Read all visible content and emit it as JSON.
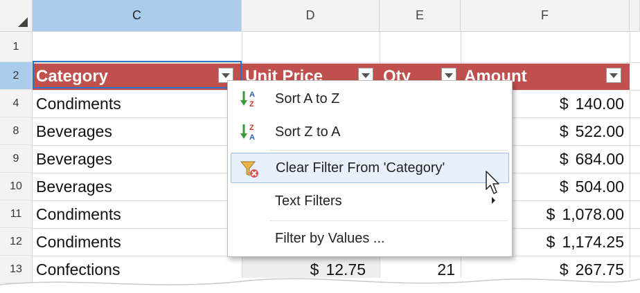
{
  "columns": [
    "C",
    "D",
    "E",
    "F"
  ],
  "rows": [
    {
      "num": "1",
      "category": "",
      "price": "",
      "qty": "",
      "amount": ""
    },
    {
      "num": "4",
      "category": "Condiments",
      "price": "",
      "qty": "",
      "amount": "140.00"
    },
    {
      "num": "8",
      "category": "Beverages",
      "price": "",
      "qty": "",
      "amount": "522.00"
    },
    {
      "num": "9",
      "category": "Beverages",
      "price": "",
      "qty": "",
      "amount": "684.00"
    },
    {
      "num": "10",
      "category": "Beverages",
      "price": "",
      "qty": "",
      "amount": "504.00"
    },
    {
      "num": "11",
      "category": "Condiments",
      "price": "",
      "qty": "",
      "amount": "1,078.00"
    },
    {
      "num": "12",
      "category": "Condiments",
      "price": "",
      "qty": "",
      "amount": "1,174.25"
    },
    {
      "num": "13",
      "category": "Confections",
      "price": "12.75",
      "qty": "21",
      "amount": "267.75"
    }
  ],
  "header_row": {
    "num": "2",
    "category": "Category",
    "unit_price": "Unit  Price",
    "qty": "Qty",
    "amount": "Amount"
  },
  "currency_symbol": "$",
  "menu": {
    "sort_asc": "Sort A to Z",
    "sort_desc": "Sort Z to A",
    "clear_filter": "Clear Filter From 'Category'",
    "text_filters": "Text Filters",
    "filter_by_values": "Filter by Values ..."
  },
  "colors": {
    "header_fill": "#c0504d",
    "selected_header": "#aacdeb",
    "active_cell_border": "#2a73c9",
    "menu_highlight": "#e7f0fb"
  }
}
